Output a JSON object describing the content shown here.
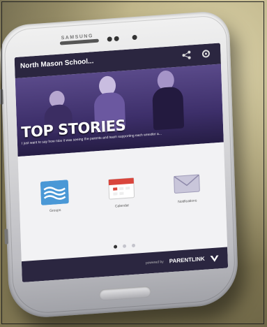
{
  "phone": {
    "brand": "SAMSUNG"
  },
  "app": {
    "title": "North Mason School...",
    "icons": [
      "share-icon",
      "settings-icon"
    ]
  },
  "hero": {
    "title": "TOP STORIES",
    "caption": "I just want to say how nice it was seeing the parents and team supporting each wrestler a..."
  },
  "tiles": [
    {
      "label": "Groups",
      "icon": "wave-icon"
    },
    {
      "label": "Calendar",
      "icon": "calendar-icon"
    },
    {
      "label": "Notifications",
      "icon": "envelope-icon"
    }
  ],
  "pager": {
    "count": 3,
    "active": 1
  },
  "footer": {
    "powered": "powered by",
    "brand": "PARENTLINK"
  },
  "colors": {
    "app_bar": "#2b2640",
    "hero": "#3d2f6a",
    "tile_blue": "#4a98d6",
    "calendar_red": "#d9453c"
  }
}
